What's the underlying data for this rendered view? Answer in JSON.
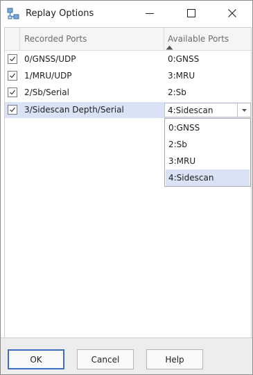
{
  "window": {
    "title": "Replay Options"
  },
  "titlebar": {
    "app_icon": "network-ports-icon",
    "minimize_icon": "minimize-icon",
    "maximize_icon": "maximize-icon",
    "close_icon": "close-icon"
  },
  "grid": {
    "columns": {
      "recorded": "Recorded Ports",
      "available": "Available Ports",
      "sort": "ascending"
    },
    "rows": [
      {
        "checked": true,
        "recorded": "0/GNSS/UDP",
        "available": "0:GNSS"
      },
      {
        "checked": true,
        "recorded": "1/MRU/UDP",
        "available": "3:MRU"
      },
      {
        "checked": true,
        "recorded": "2/Sb/Serial",
        "available": "2:Sb"
      },
      {
        "checked": true,
        "recorded": "3/Sidescan Depth/Serial",
        "available": "4:Sidescan"
      }
    ],
    "selected_row": 3
  },
  "dropdown": {
    "current": "4:Sidescan",
    "options": [
      "0:GNSS",
      "2:Sb",
      "3:MRU",
      "4:Sidescan"
    ],
    "highlighted": "4:Sidescan"
  },
  "buttons": {
    "ok": "OK",
    "cancel": "Cancel",
    "help": "Help"
  },
  "colors": {
    "selection": "#d9e3f5",
    "default_button_border": "#3c6fbf"
  }
}
